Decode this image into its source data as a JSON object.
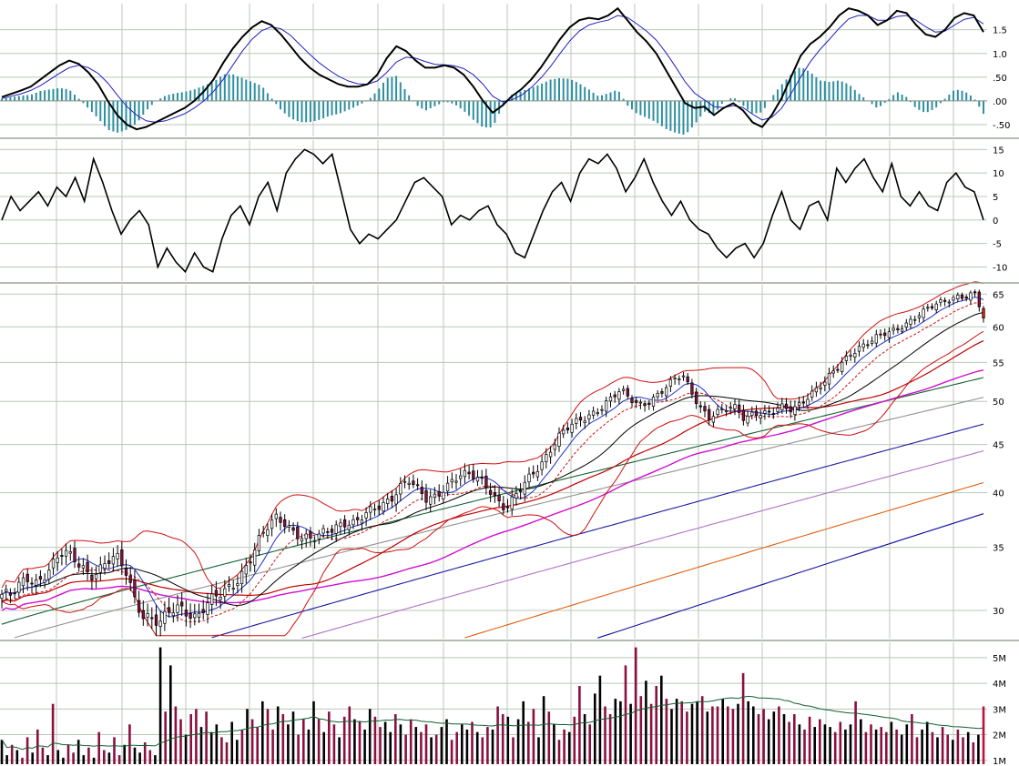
{
  "chart_data": [
    {
      "panel": "macd",
      "type": "line",
      "ylim": [
        -0.75,
        2.05
      ],
      "y_ticks": [
        {
          "value": 1.5,
          "label": "1.5"
        },
        {
          "value": 1.0,
          "label": "1.0"
        },
        {
          "value": 0.5,
          "label": ".50"
        },
        {
          "value": 0.0,
          "label": ".00"
        },
        {
          "value": -0.5,
          "label": "-.50"
        }
      ],
      "grid": true,
      "series": [
        {
          "role": "macd-line",
          "color": "#000000",
          "values": [
            0.08,
            0.15,
            0.22,
            0.3,
            0.45,
            0.6,
            0.75,
            0.85,
            0.78,
            0.6,
            0.35,
            0.0,
            -0.3,
            -0.5,
            -0.6,
            -0.55,
            -0.45,
            -0.35,
            -0.25,
            -0.15,
            0.0,
            0.2,
            0.45,
            0.8,
            1.1,
            1.35,
            1.55,
            1.68,
            1.6,
            1.4,
            1.15,
            0.9,
            0.7,
            0.55,
            0.45,
            0.35,
            0.3,
            0.3,
            0.35,
            0.55,
            0.9,
            1.15,
            1.05,
            0.85,
            0.7,
            0.7,
            0.75,
            0.7,
            0.55,
            0.3,
            0.0,
            -0.25,
            -0.1,
            0.1,
            0.25,
            0.45,
            0.7,
            1.0,
            1.3,
            1.55,
            1.7,
            1.75,
            1.72,
            1.8,
            1.95,
            1.7,
            1.45,
            1.25,
            1.0,
            0.65,
            0.3,
            -0.05,
            -0.15,
            -0.12,
            -0.3,
            -0.15,
            -0.05,
            -0.2,
            -0.45,
            -0.55,
            -0.3,
            0.05,
            0.5,
            0.95,
            1.2,
            1.35,
            1.55,
            1.8,
            1.95,
            1.9,
            1.8,
            1.6,
            1.7,
            1.9,
            1.85,
            1.6,
            1.4,
            1.35,
            1.5,
            1.75,
            1.85,
            1.8,
            1.45
          ]
        },
        {
          "role": "signal-line",
          "color": "#2020c0",
          "values": [
            0.05,
            0.1,
            0.15,
            0.22,
            0.32,
            0.45,
            0.58,
            0.7,
            0.75,
            0.7,
            0.58,
            0.38,
            0.12,
            -0.12,
            -0.3,
            -0.42,
            -0.45,
            -0.42,
            -0.35,
            -0.27,
            -0.15,
            0.0,
            0.2,
            0.45,
            0.75,
            1.05,
            1.3,
            1.48,
            1.56,
            1.52,
            1.38,
            1.18,
            0.98,
            0.8,
            0.65,
            0.52,
            0.42,
            0.36,
            0.35,
            0.42,
            0.6,
            0.82,
            0.92,
            0.9,
            0.83,
            0.77,
            0.76,
            0.74,
            0.68,
            0.55,
            0.35,
            0.1,
            -0.02,
            0.02,
            0.12,
            0.28,
            0.48,
            0.72,
            1.0,
            1.26,
            1.47,
            1.6,
            1.66,
            1.7,
            1.8,
            1.76,
            1.62,
            1.47,
            1.28,
            1.02,
            0.72,
            0.4,
            0.16,
            0.02,
            -0.12,
            -0.14,
            -0.1,
            -0.14,
            -0.28,
            -0.4,
            -0.35,
            -0.16,
            0.15,
            0.5,
            0.82,
            1.08,
            1.3,
            1.53,
            1.73,
            1.8,
            1.8,
            1.7,
            1.7,
            1.78,
            1.8,
            1.7,
            1.56,
            1.45,
            1.47,
            1.6,
            1.72,
            1.76,
            1.62
          ]
        },
        {
          "role": "histogram",
          "color": "#2e8fa0",
          "bar_series": true
        }
      ]
    },
    {
      "panel": "momentum",
      "type": "line",
      "ylim": [
        -13,
        17
      ],
      "y_ticks": [
        {
          "value": 15,
          "label": "15"
        },
        {
          "value": 10,
          "label": "10"
        },
        {
          "value": 5,
          "label": "5"
        },
        {
          "value": 0,
          "label": "0"
        },
        {
          "value": -5,
          "label": "-5"
        },
        {
          "value": -10,
          "label": "-10"
        }
      ],
      "grid": true,
      "series": [
        {
          "role": "oscillator",
          "color": "#000000",
          "values": [
            0,
            5,
            2,
            4,
            6,
            3,
            7,
            5,
            9,
            4,
            13,
            8,
            2,
            -3,
            0,
            2,
            -1,
            -10,
            -6,
            -9,
            -11,
            -7,
            -10,
            -11,
            -4,
            1,
            3,
            -1,
            5,
            8,
            2,
            10,
            13,
            15,
            14,
            12,
            14,
            6,
            -2,
            -5,
            -3,
            -4,
            -2,
            0,
            4,
            8,
            9,
            7,
            5,
            -1,
            1,
            0,
            2,
            3,
            -1,
            -3,
            -7,
            -8,
            -3,
            2,
            6,
            8,
            4,
            10,
            13,
            12,
            14,
            11,
            6,
            9,
            13,
            8,
            4,
            1,
            4,
            0,
            -2,
            -3,
            -6,
            -8,
            -6,
            -5,
            -8,
            -5,
            1,
            6,
            0,
            -2,
            3,
            4,
            0,
            11,
            8,
            11,
            13,
            9,
            6,
            12,
            5,
            3,
            6,
            3,
            2,
            8,
            10,
            7,
            6,
            0
          ]
        }
      ]
    },
    {
      "panel": "price",
      "type": "candlestick",
      "ylim": [
        28,
        66.5
      ],
      "y_ticks": [
        {
          "value": 65,
          "label": "65"
        },
        {
          "value": 60,
          "label": "60"
        },
        {
          "value": 55,
          "label": "55"
        },
        {
          "value": 50,
          "label": "50"
        },
        {
          "value": 45,
          "label": "45"
        },
        {
          "value": 40,
          "label": "40"
        },
        {
          "value": 35,
          "label": "35"
        },
        {
          "value": 30,
          "label": "30"
        }
      ],
      "grid": true,
      "close": [
        31.2,
        31.0,
        31.8,
        32.5,
        32.2,
        33.0,
        33.8,
        34.5,
        34.0,
        33.5,
        32.8,
        33.2,
        33.8,
        34.0,
        33.0,
        31.0,
        29.8,
        29.4,
        29.0,
        29.8,
        30.2,
        30.0,
        29.6,
        30.4,
        30.8,
        31.2,
        31.8,
        32.8,
        34.0,
        35.5,
        36.6,
        37.5,
        37.2,
        36.5,
        36.0,
        35.6,
        35.9,
        36.4,
        37.0,
        37.4,
        37.2,
        37.8,
        38.2,
        38.8,
        39.5,
        40.8,
        41.3,
        40.2,
        39.2,
        39.6,
        40.6,
        41.4,
        41.8,
        41.6,
        41.2,
        40.6,
        39.4,
        38.6,
        39.5,
        40.6,
        41.8,
        43.0,
        44.6,
        46.0,
        46.8,
        47.4,
        48.0,
        48.8,
        49.6,
        50.6,
        51.2,
        50.2,
        49.6,
        50.0,
        50.8,
        51.6,
        52.6,
        53.2,
        51.2,
        49.4,
        48.2,
        48.6,
        49.0,
        49.2,
        48.0,
        48.8,
        48.6,
        48.4,
        49.2,
        49.0,
        49.6,
        50.6,
        51.4,
        52.2,
        53.6,
        55.0,
        56.4,
        57.2,
        57.6,
        58.4,
        59.0,
        59.6,
        60.4,
        61.2,
        62.0,
        62.8,
        63.6,
        64.2,
        64.8,
        64.6,
        65.0,
        61.3
      ],
      "bands_and_averages": [
        {
          "role": "bollinger-upper",
          "color": "#d01010"
        },
        {
          "role": "bollinger-lower",
          "color": "#d01010"
        },
        {
          "role": "ma-short",
          "color": "#2030c0"
        },
        {
          "role": "ma-short-dashed",
          "color": "#d01010"
        },
        {
          "role": "ma-1",
          "color": "#000000"
        },
        {
          "role": "ma-2",
          "color": "#c00000"
        },
        {
          "role": "ma-3",
          "color": "#d010d0"
        },
        {
          "role": "ma-4",
          "color": "#106030"
        },
        {
          "role": "ma-5",
          "color": "#909090"
        },
        {
          "role": "ma-6",
          "color": "#1a1aa0"
        },
        {
          "role": "ma-7",
          "color": "#b070c8"
        },
        {
          "role": "ma-8",
          "color": "#e06010"
        },
        {
          "role": "ma-9",
          "color": "#1010a0"
        }
      ],
      "up_color": "#ffffff",
      "down_color": "#8b1040",
      "last_candle_color": "#d02010"
    },
    {
      "panel": "volume",
      "type": "bar",
      "ylim": [
        0.85,
        5.6
      ],
      "unit": "M",
      "y_ticks": [
        {
          "value": 5,
          "label": "5M"
        },
        {
          "value": 4,
          "label": "4M"
        },
        {
          "value": 3,
          "label": "3M"
        },
        {
          "value": 2,
          "label": "2M"
        },
        {
          "value": 1,
          "label": "1M"
        }
      ],
      "grid": true,
      "values": [
        1.8,
        1.2,
        1.6,
        1.4,
        1.1,
        1.9,
        1.3,
        2.2,
        1.5,
        1.2,
        3.2,
        1.4,
        1.1,
        1.6,
        1.3,
        1.8,
        1.2,
        1.5,
        1.1,
        2.1,
        1.4,
        1.3,
        1.9,
        1.2,
        1.6,
        2.4,
        1.5,
        1.3,
        1.7,
        1.4,
        1.2,
        5.4,
        2.9,
        4.7,
        3.1,
        2.6,
        2.0,
        2.8,
        3.0,
        2.3,
        2.9,
        2.1,
        2.4,
        1.9,
        1.7,
        2.5,
        1.8,
        2.2,
        3.0,
        2.6,
        2.3,
        3.3,
        3.0,
        2.2,
        3.1,
        2.8,
        2.4,
        2.9,
        2.0,
        2.6,
        2.2,
        3.3,
        2.6,
        2.1,
        2.9,
        2.4,
        1.9,
        2.7,
        3.1,
        2.6,
        2.5,
        2.2,
        3.0,
        2.7,
        2.3,
        2.5,
        2.1,
        2.8,
        2.4,
        2.0,
        2.6,
        2.3,
        2.1,
        2.4,
        1.9,
        2.0,
        2.3,
        2.6,
        1.8,
        2.1,
        2.4,
        2.2,
        2.5,
        2.1,
        1.9,
        2.3,
        2.2,
        3.1,
        2.8,
        2.7,
        1.9,
        2.6,
        3.3,
        2.5,
        3.0,
        1.9,
        3.5,
        2.9,
        2.4,
        1.8,
        2.2,
        2.1,
        2.7,
        3.9,
        2.8,
        2.4,
        3.6,
        4.3,
        3.1,
        2.8,
        3.4,
        3.3,
        4.7,
        3.2,
        5.4,
        3.5,
        4.1,
        3.2,
        3.9,
        4.3,
        3.4,
        3.0,
        3.4,
        3.3,
        2.9,
        3.2,
        3.3,
        3.5,
        2.9,
        3.1,
        3.1,
        3.4,
        3.1,
        3.0,
        3.2,
        4.4,
        3.3,
        3.1,
        2.8,
        3.0,
        2.6,
        2.9,
        3.1,
        2.8,
        2.5,
        2.8,
        2.4,
        2.2,
        2.7,
        2.3,
        2.6,
        2.4,
        2.3,
        2.1,
        2.5,
        2.2,
        2.4,
        3.3,
        2.6,
        2.1,
        2.4,
        2.2,
        2.3,
        2.1,
        2.5,
        2.2,
        2.0,
        2.4,
        2.8,
        1.9,
        2.2,
        2.5,
        2.1,
        1.9,
        2.3,
        2.0,
        1.8,
        2.2,
        1.9,
        2.1,
        1.7,
        2.0,
        3.1
      ],
      "series": [
        {
          "role": "volume-average",
          "color": "#106030"
        }
      ]
    }
  ]
}
